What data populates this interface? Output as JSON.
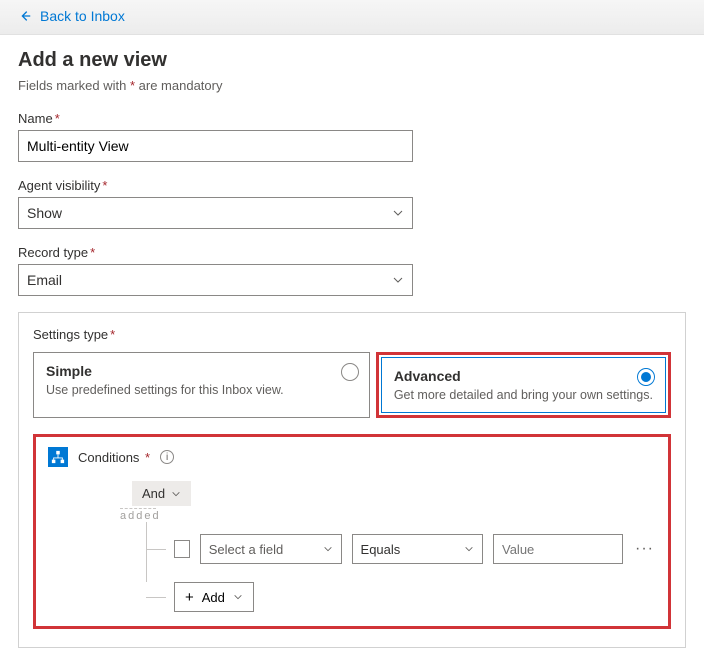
{
  "nav": {
    "back_label": "Back to Inbox"
  },
  "page": {
    "title": "Add a new view",
    "mandatory_pre": "Fields marked with ",
    "mandatory_ast": "*",
    "mandatory_post": " are mandatory"
  },
  "fields": {
    "name": {
      "label": "Name",
      "value": "Multi-entity View"
    },
    "agent_visibility": {
      "label": "Agent visibility",
      "value": "Show"
    },
    "record_type": {
      "label": "Record type",
      "value": "Email"
    }
  },
  "settings_type": {
    "label": "Settings type",
    "simple": {
      "title": "Simple",
      "desc": "Use predefined settings for this Inbox view."
    },
    "advanced": {
      "title": "Advanced",
      "desc": "Get more detailed and bring your own settings."
    },
    "selected": "advanced"
  },
  "conditions": {
    "title": "Conditions",
    "logic": "And",
    "ghost": "added",
    "row": {
      "field_placeholder": "Select a field",
      "operator": "Equals",
      "value_placeholder": "Value"
    },
    "add_label": "Add"
  }
}
